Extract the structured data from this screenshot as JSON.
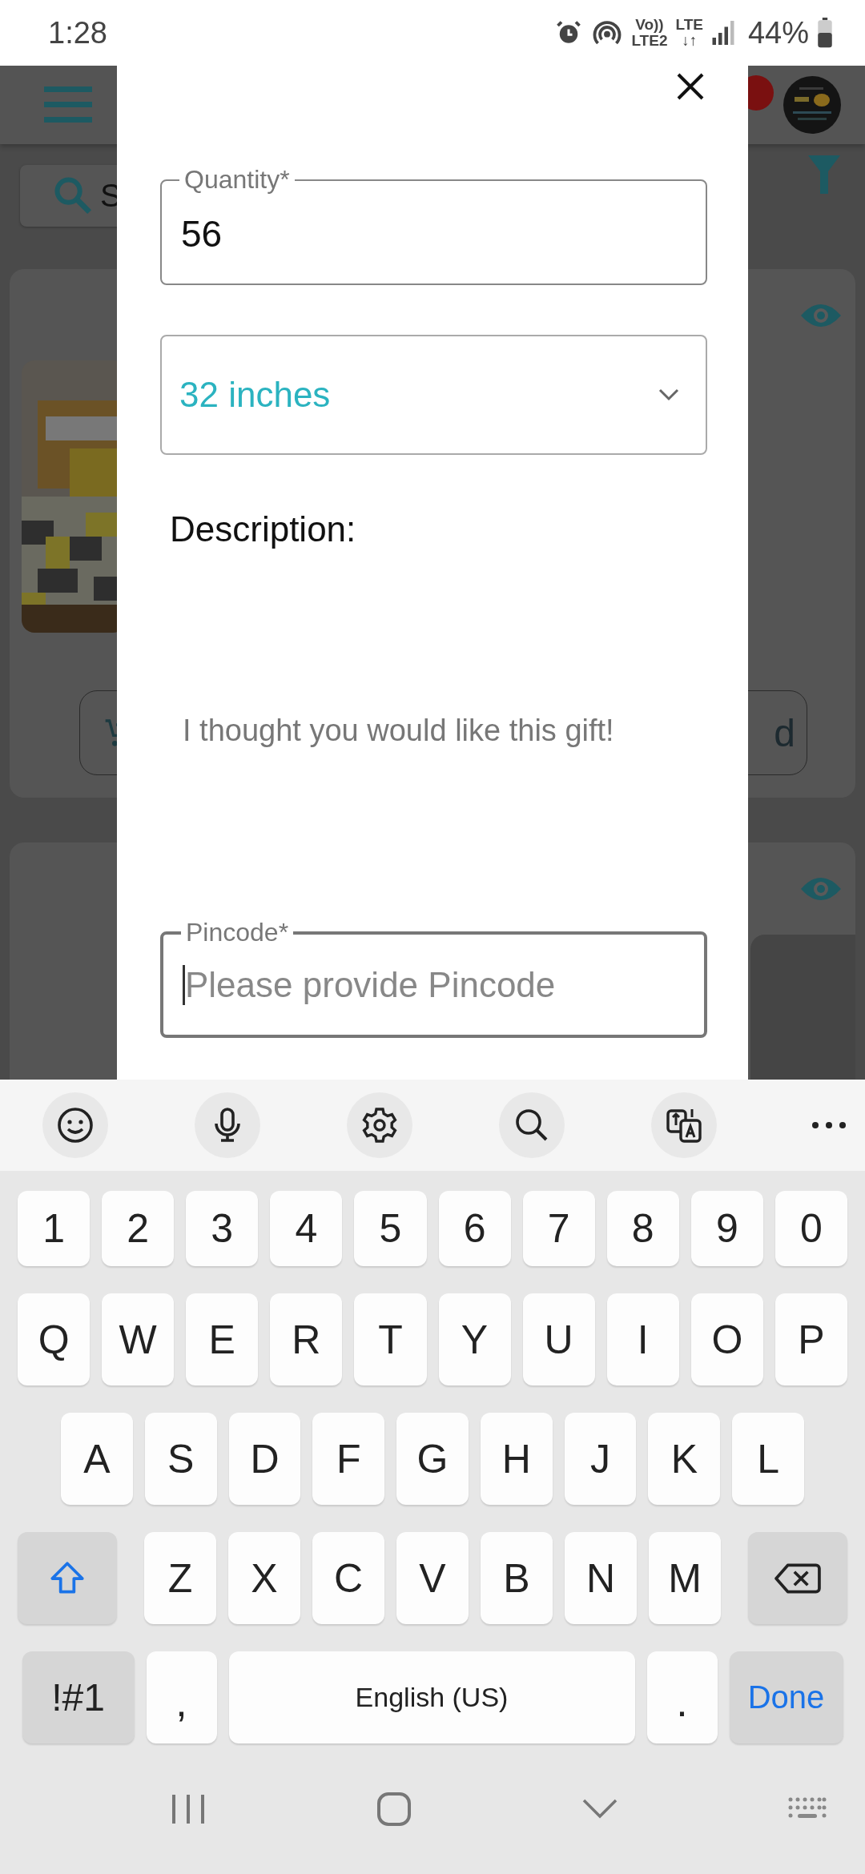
{
  "status_bar": {
    "time": "1:28",
    "network_labels": [
      {
        "top": "Vo))",
        "bottom": "LTE2"
      },
      {
        "top": "LTE",
        "bottom": "↓↑"
      }
    ],
    "battery": "44%"
  },
  "background": {
    "search_placeholder": "S",
    "cards": [
      {
        "kind": "product",
        "button_text": "d"
      },
      {
        "kind": "loading"
      }
    ]
  },
  "modal": {
    "quantity": {
      "label": "Quantity*",
      "value": "56"
    },
    "size_select": {
      "value": "32 inches"
    },
    "description": {
      "label": "Description:",
      "text": "I thought you would like this gift!"
    },
    "pincode": {
      "label": "Pincode*",
      "placeholder": "Please provide Pincode",
      "focused": true
    }
  },
  "keyboard": {
    "rows": [
      {
        "kind": "numbers",
        "keys": [
          "1",
          "2",
          "3",
          "4",
          "5",
          "6",
          "7",
          "8",
          "9",
          "0"
        ]
      },
      {
        "kind": "letters",
        "keys": [
          "Q",
          "W",
          "E",
          "R",
          "T",
          "Y",
          "U",
          "I",
          "O",
          "P"
        ]
      },
      {
        "kind": "home",
        "keys": [
          "A",
          "S",
          "D",
          "F",
          "G",
          "H",
          "J",
          "K",
          "L"
        ]
      },
      {
        "kind": "shift",
        "keys": [
          "Z",
          "X",
          "C",
          "V",
          "B",
          "N",
          "M"
        ]
      }
    ],
    "bottom": {
      "symbols": "!#1",
      "comma": ",",
      "space": "English (US)",
      "period": ".",
      "done": "Done"
    }
  }
}
